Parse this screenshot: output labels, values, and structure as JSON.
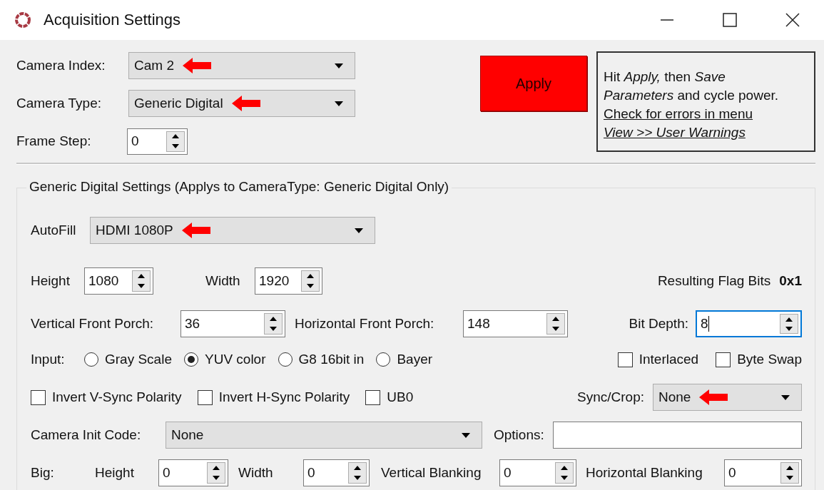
{
  "window": {
    "title": "Acquisition Settings"
  },
  "camera_index": {
    "label": "Camera Index:",
    "value": "Cam 2",
    "arrow": true
  },
  "camera_type": {
    "label": "Camera Type:",
    "value": "Generic Digital",
    "arrow": true
  },
  "frame_step": {
    "label": "Frame Step:",
    "value": "0"
  },
  "apply_button": "Apply",
  "help": {
    "text": "Hit *Apply,* then *Save* *Parameters* and cycle power.",
    "links": [
      "Check for errors in menu",
      "View >> User Warnings"
    ]
  },
  "group": {
    "title": "Generic Digital Settings (Applys to CameraType: Generic Digital Only)",
    "autofill": {
      "label": "AutoFill",
      "value": "HDMI 1080P",
      "arrow": true
    },
    "height": {
      "label": "Height",
      "value": "1080"
    },
    "width": {
      "label": "Width",
      "value": "1920"
    },
    "flag_bits": {
      "label": "Resulting Flag Bits",
      "value": "0x1"
    },
    "vertical_front_porch": {
      "label": "Vertical Front Porch:",
      "value": "36"
    },
    "horizontal_front_porch": {
      "label": "Horizontal Front Porch:",
      "value": "148"
    },
    "bit_depth": {
      "label": "Bit Depth:",
      "value": "8",
      "focused": true
    },
    "input": {
      "label": "Input:",
      "options": [
        {
          "label": "Gray Scale",
          "selected": false
        },
        {
          "label": "YUV color",
          "selected": true
        },
        {
          "label": "G8 16bit in",
          "selected": false
        },
        {
          "label": "Bayer",
          "selected": false
        }
      ]
    },
    "flags": [
      {
        "label": "Interlaced",
        "checked": false
      },
      {
        "label": "Byte Swap",
        "checked": false
      }
    ],
    "polarity": [
      {
        "label": "Invert V-Sync Polarity",
        "checked": false
      },
      {
        "label": "Invert H-Sync Polarity",
        "checked": false
      },
      {
        "label": "UB0",
        "checked": false
      }
    ],
    "sync_crop": {
      "label": "Sync/Crop:",
      "value": "None",
      "arrow": true
    },
    "init_code": {
      "label": "Camera Init Code:",
      "value": "None"
    },
    "options": {
      "label": "Options:"
    },
    "big": {
      "label": "Big:",
      "fields": [
        {
          "label": "Height",
          "value": "0"
        },
        {
          "label": "Width",
          "value": "0"
        },
        {
          "label": "Vertical Blanking",
          "value": "0"
        },
        {
          "label": "Horizontal Blanking",
          "value": "0"
        }
      ]
    }
  }
}
